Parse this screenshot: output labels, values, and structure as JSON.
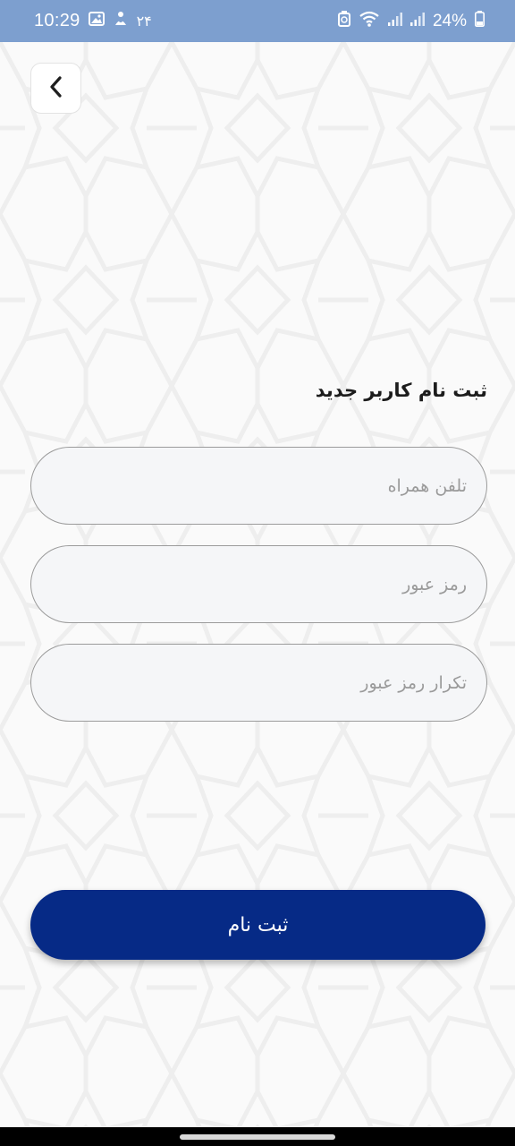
{
  "status_bar": {
    "time": "10:29",
    "date_digits": "۲۴",
    "battery_percent": "24%",
    "icons": [
      "gallery-icon",
      "notification-icon",
      "recycle-icon",
      "wifi-icon",
      "signal-icon",
      "signal-icon-2",
      "battery-icon"
    ]
  },
  "header": {
    "back_icon": "chevron-left-icon"
  },
  "form": {
    "title": "ثبت نام کاربر جدید",
    "phone_placeholder": "تلفن همراه",
    "password_placeholder": "رمز عبور",
    "confirm_password_placeholder": "تکرار رمز عبور",
    "submit_label": "ثبت نام"
  },
  "colors": {
    "status_bar": "#7d9fcf",
    "primary": "#062a86",
    "field_background": "#f5f6f8",
    "field_border": "#9b9b9b"
  }
}
